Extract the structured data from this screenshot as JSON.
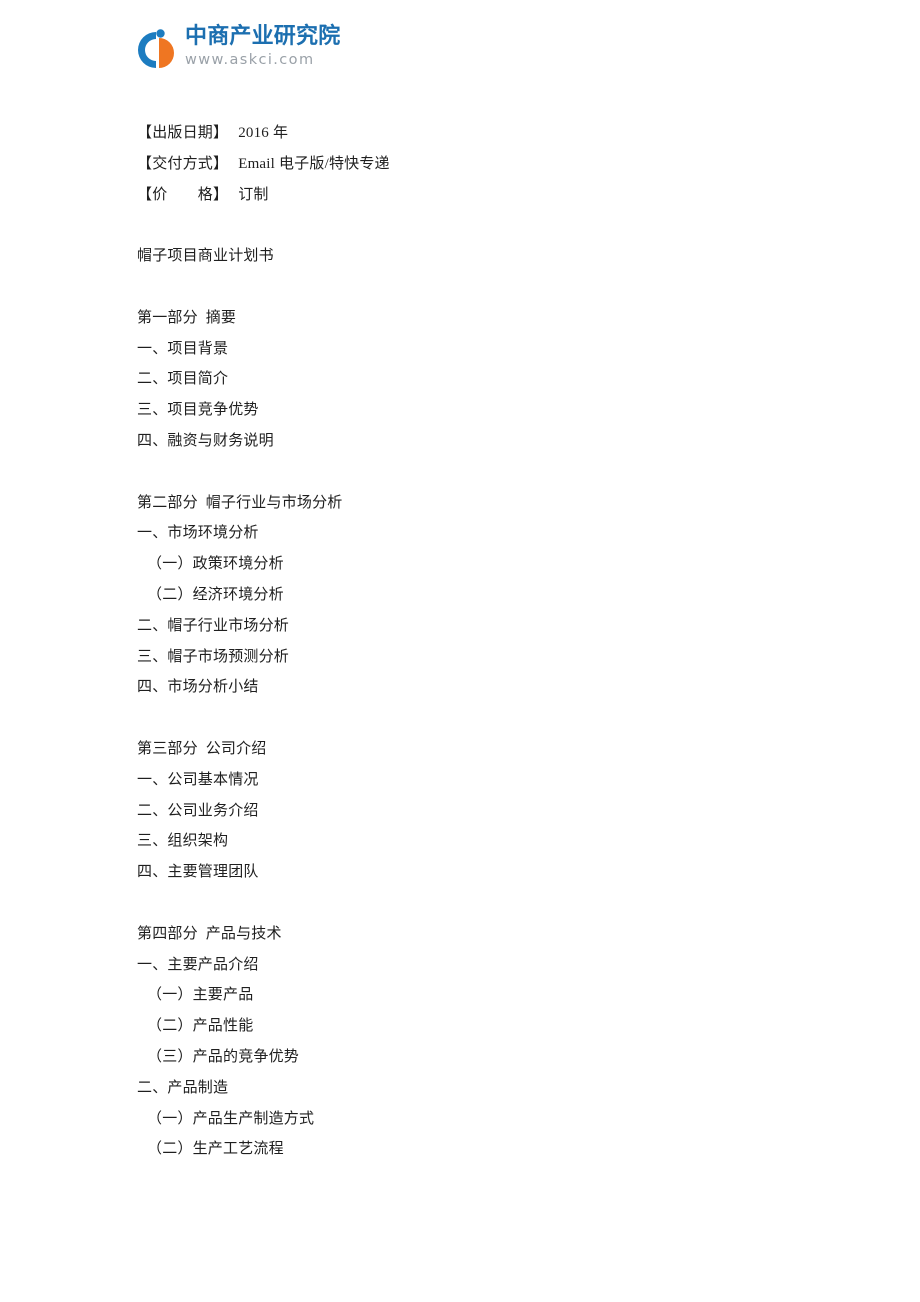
{
  "logo": {
    "mark_icon": "askci-circle-logo",
    "company_cn": "中商产业研究院",
    "website": "www.askci.com",
    "blue": "#1c6fb0",
    "orange": "#ef7622",
    "gray": "#9aa1a8"
  },
  "meta": [
    {
      "label": "【出版日期】",
      "value": "2016 年"
    },
    {
      "label": "【交付方式】",
      "value": "Email 电子版/特快专递"
    },
    {
      "label": "【价　　格】",
      "value": "订制"
    }
  ],
  "title": "帽子项目商业计划书",
  "sections": [
    {
      "heading": "第一部分  摘要",
      "items": [
        {
          "text": "一、项目背景",
          "indent": 0
        },
        {
          "text": "二、项目简介",
          "indent": 0
        },
        {
          "text": "三、项目竞争优势",
          "indent": 0
        },
        {
          "text": "四、融资与财务说明",
          "indent": 0
        }
      ]
    },
    {
      "heading": "第二部分  帽子行业与市场分析",
      "items": [
        {
          "text": "一、市场环境分析",
          "indent": 0
        },
        {
          "text": "（一）政策环境分析",
          "indent": 1
        },
        {
          "text": "（二）经济环境分析",
          "indent": 1
        },
        {
          "text": "二、帽子行业市场分析",
          "indent": 0
        },
        {
          "text": "三、帽子市场预测分析",
          "indent": 0
        },
        {
          "text": "四、市场分析小结",
          "indent": 0
        }
      ]
    },
    {
      "heading": "第三部分  公司介绍",
      "items": [
        {
          "text": "一、公司基本情况",
          "indent": 0
        },
        {
          "text": "二、公司业务介绍",
          "indent": 0
        },
        {
          "text": "三、组织架构",
          "indent": 0
        },
        {
          "text": "四、主要管理团队",
          "indent": 0
        }
      ]
    },
    {
      "heading": "第四部分  产品与技术",
      "items": [
        {
          "text": "一、主要产品介绍",
          "indent": 0
        },
        {
          "text": "（一）主要产品",
          "indent": 1
        },
        {
          "text": "（二）产品性能",
          "indent": 1
        },
        {
          "text": "（三）产品的竞争优势",
          "indent": 1
        },
        {
          "text": "二、产品制造",
          "indent": 0
        },
        {
          "text": "（一）产品生产制造方式",
          "indent": 1
        },
        {
          "text": "（二）生产工艺流程",
          "indent": 1
        }
      ]
    }
  ]
}
